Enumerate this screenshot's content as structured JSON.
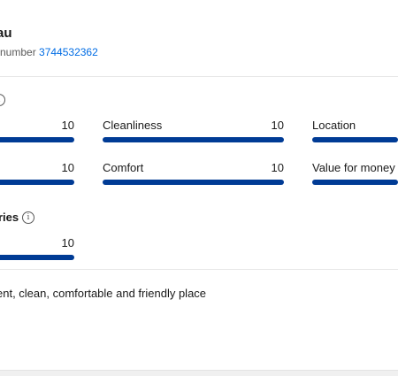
{
  "property": {
    "name_fragment": "au",
    "ref_label": "number",
    "ref_number": "3744532362"
  },
  "rating_categories": [
    {
      "label": "",
      "score": "10",
      "fill": 1.0
    },
    {
      "label": "Cleanliness",
      "score": "10",
      "fill": 1.0
    },
    {
      "label": "Location",
      "score": "",
      "fill": 1.0
    },
    {
      "label": "",
      "score": "10",
      "fill": 1.0
    },
    {
      "label": "Comfort",
      "score": "10",
      "fill": 1.0
    },
    {
      "label": "Value for money",
      "score": "",
      "fill": 1.0
    },
    {
      "label": "",
      "score": "10",
      "fill": 1.0
    }
  ],
  "subsection": {
    "title_fragment": "ries"
  },
  "review": {
    "text": "ent, clean, comfortable and friendly place"
  },
  "colors": {
    "bar": "#003b95",
    "link": "#006ce4",
    "divider": "#e7e7e7"
  }
}
